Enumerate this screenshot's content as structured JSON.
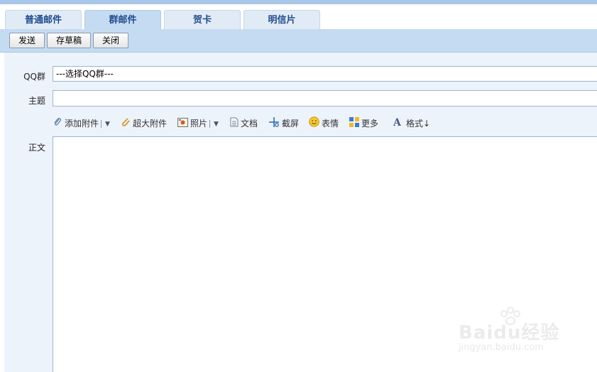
{
  "tabs": [
    {
      "label": "普通邮件",
      "active": false
    },
    {
      "label": "群邮件",
      "active": true
    },
    {
      "label": "贺卡",
      "active": false
    },
    {
      "label": "明信片",
      "active": false
    }
  ],
  "toolbar": {
    "send_label": "发送",
    "draft_label": "存草稿",
    "close_label": "关闭"
  },
  "form": {
    "qq_group_label": "QQ群",
    "qq_group_value": "---选择QQ群---",
    "subject_label": "主题",
    "subject_value": "",
    "body_label": "正文"
  },
  "attachments": {
    "add_attachment": "添加附件",
    "large_attachment": "超大附件",
    "photo": "照片",
    "document": "文档",
    "screenshot": "截屏",
    "emoticon": "表情",
    "more": "更多",
    "format": "格式↓"
  },
  "watermark": {
    "brand": "Baidu经验",
    "url": "jingyan.baidu.com"
  },
  "colors": {
    "accent": "#c5dbf2",
    "tab_text": "#1f4d8c",
    "compose_bg": "#edf3fa"
  }
}
